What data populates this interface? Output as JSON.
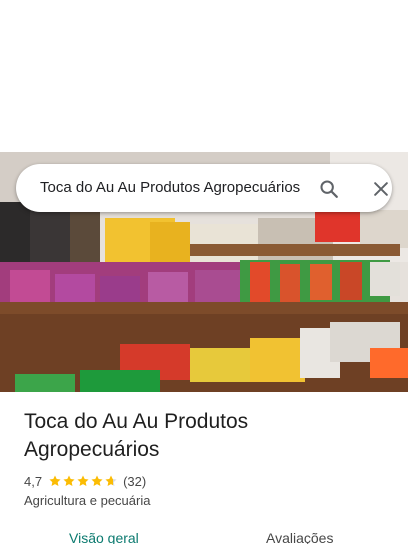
{
  "search": {
    "query": "Toca do Au Au Produtos Agropecuários"
  },
  "place": {
    "title": "Toca do Au Au Produtos Agropecuários",
    "rating": "4,7",
    "rating_value": 4.7,
    "review_count": "(32)",
    "category": "Agricultura e pecuária"
  },
  "tabs": [
    {
      "label": "Visão geral",
      "active": true
    },
    {
      "label": "Avaliações",
      "active": false
    }
  ],
  "colors": {
    "accent": "#0b7a6f",
    "star": "#fbbc04"
  }
}
